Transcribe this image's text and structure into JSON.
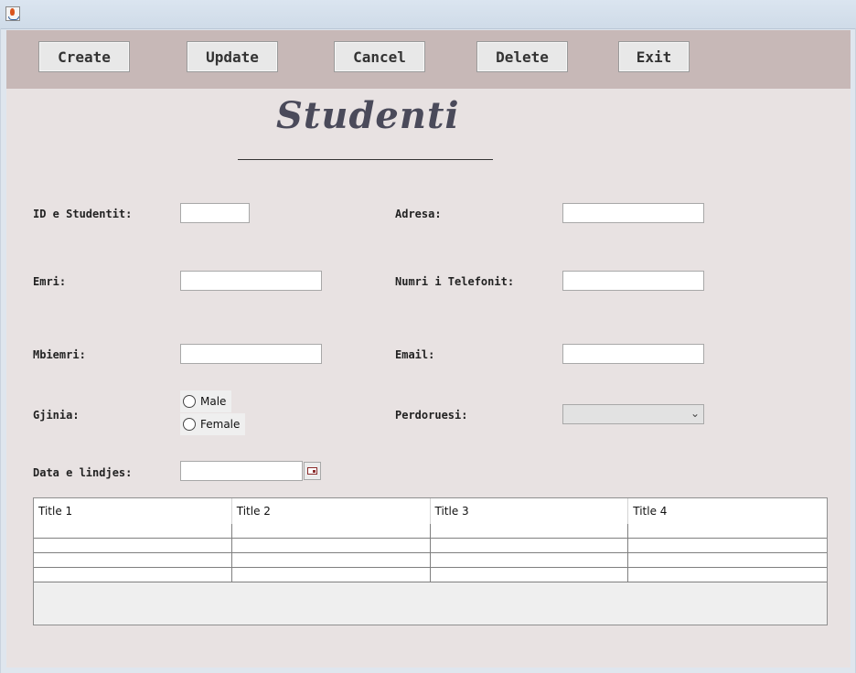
{
  "window": {
    "title": ""
  },
  "toolbar": {
    "buttons": [
      {
        "label": "Create"
      },
      {
        "label": "Update"
      },
      {
        "label": "Cancel"
      },
      {
        "label": "Delete"
      },
      {
        "label": "Exit"
      }
    ]
  },
  "form": {
    "heading": "Studenti",
    "id_label": "ID e Studentit:",
    "id_value": "",
    "emri_label": "Emri:",
    "emri_value": "",
    "mbiemri_label": "Mbiemri:",
    "mbiemri_value": "",
    "gjinia_label": "Gjinia:",
    "gender_options": [
      "Male",
      "Female"
    ],
    "data_label": "Data e lindjes:",
    "data_value": "",
    "adresa_label": "Adresa:",
    "adresa_value": "",
    "telefon_label": "Numri i Telefonit:",
    "telefon_value": "",
    "email_label": "Email:",
    "email_value": "",
    "perdoruesi_label": "Perdoruesi:",
    "perdoruesi_value": ""
  },
  "table": {
    "columns": [
      "Title 1",
      "Title 2",
      "Title 3",
      "Title 4"
    ],
    "rows": [
      [
        "",
        "",
        "",
        ""
      ],
      [
        "",
        "",
        "",
        ""
      ],
      [
        "",
        "",
        "",
        ""
      ],
      [
        "",
        "",
        "",
        ""
      ]
    ]
  },
  "icons": {
    "app": "java-coffee-cup-icon",
    "calendar": "calendar-icon",
    "combo_arrow": "chevron-down-icon"
  },
  "colors": {
    "toolbar_bg": "#c7b8b7",
    "content_bg": "#e8e2e2",
    "heading": "#4a4a5a"
  }
}
